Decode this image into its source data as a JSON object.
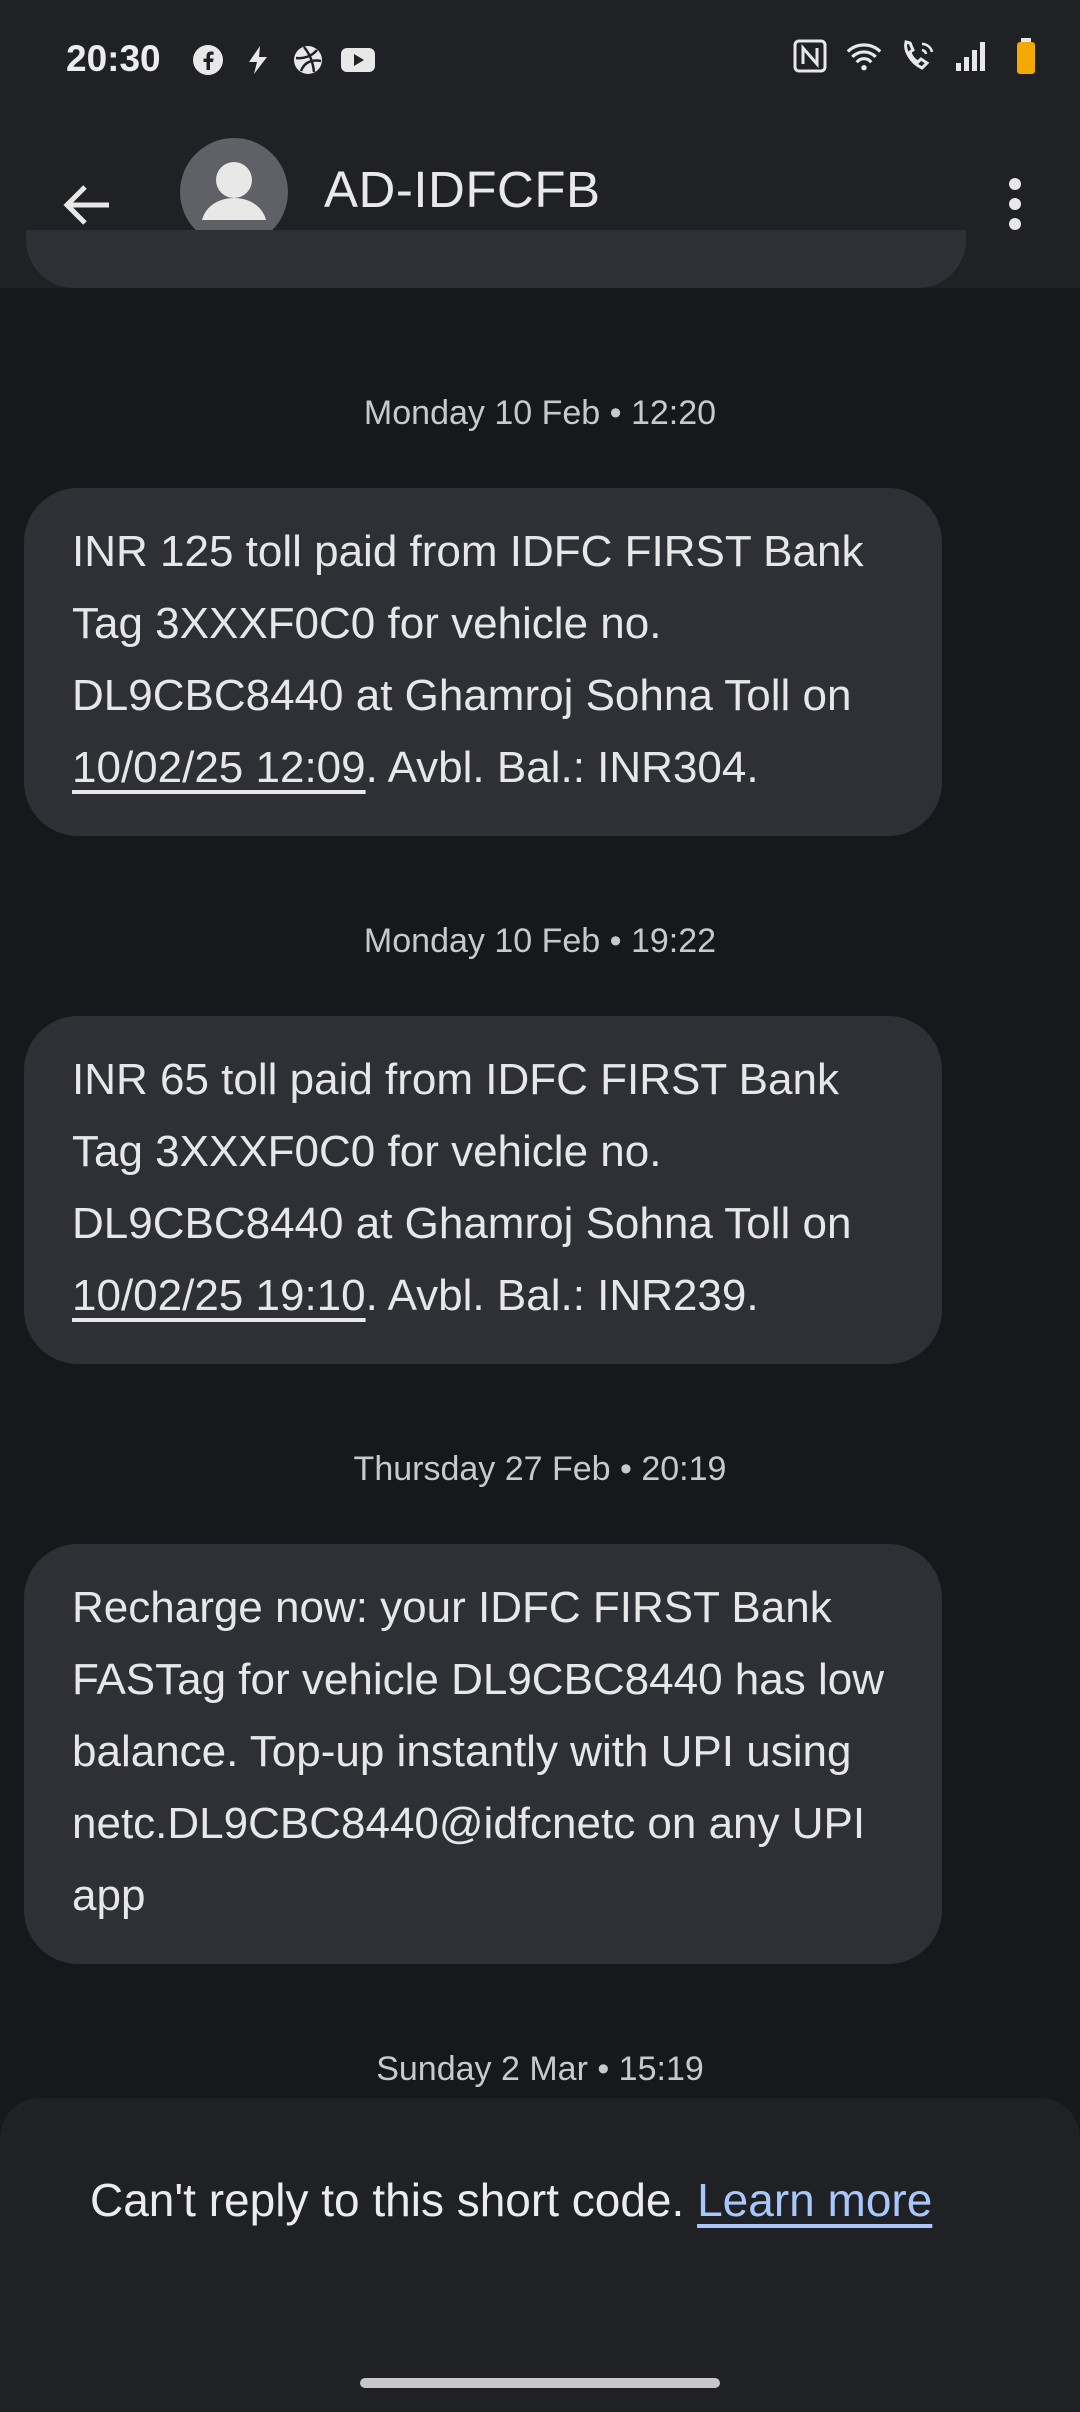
{
  "status_bar": {
    "time": "20:30",
    "left_icons": [
      "facebook-icon",
      "bolt-icon",
      "dribbble-icon",
      "youtube-icon"
    ],
    "right_icons": [
      "nfc-icon",
      "wifi-icon",
      "wifi-call-icon",
      "signal-icon",
      "battery-icon"
    ]
  },
  "header": {
    "title": "AD-IDFCFB",
    "back_icon": "arrow-back-icon",
    "avatar_icon": "person-icon",
    "menu_icon": "more-vert-icon"
  },
  "messages": [
    {
      "date": "Monday 10 Feb • 12:20",
      "pre": "INR 125 toll paid from IDFC FIRST Bank Tag 3XXXF0C0 for vehicle no. DL9CBC8440 at Ghamroj Sohna Toll on ",
      "link": "10/02/25 12:09",
      "post": ". Avbl. Bal.: INR304."
    },
    {
      "date": "Monday 10 Feb • 19:22",
      "pre": "INR 65 toll paid from IDFC FIRST Bank Tag 3XXXF0C0 for vehicle no. DL9CBC8440 at Ghamroj Sohna Toll on ",
      "link": "10/02/25 19:10",
      "post": ". Avbl. Bal.: INR239."
    },
    {
      "date": "Thursday 27 Feb • 20:19",
      "text": "Recharge now: your IDFC FIRST Bank FASTag for vehicle DL9CBC8440 has low balance. Top-up instantly with UPI using netc.DL9CBC8440@idfcnetc on any UPI app"
    },
    {
      "date": "Sunday 2 Mar • 15:19"
    }
  ],
  "footer": {
    "notice": "Can't reply to this short code. ",
    "link": "Learn more"
  },
  "colors": {
    "background": "#17181c",
    "bar": "#202124",
    "bubble": "#2e3035",
    "link": "#a8c7fa",
    "battery": "#f2a900"
  }
}
